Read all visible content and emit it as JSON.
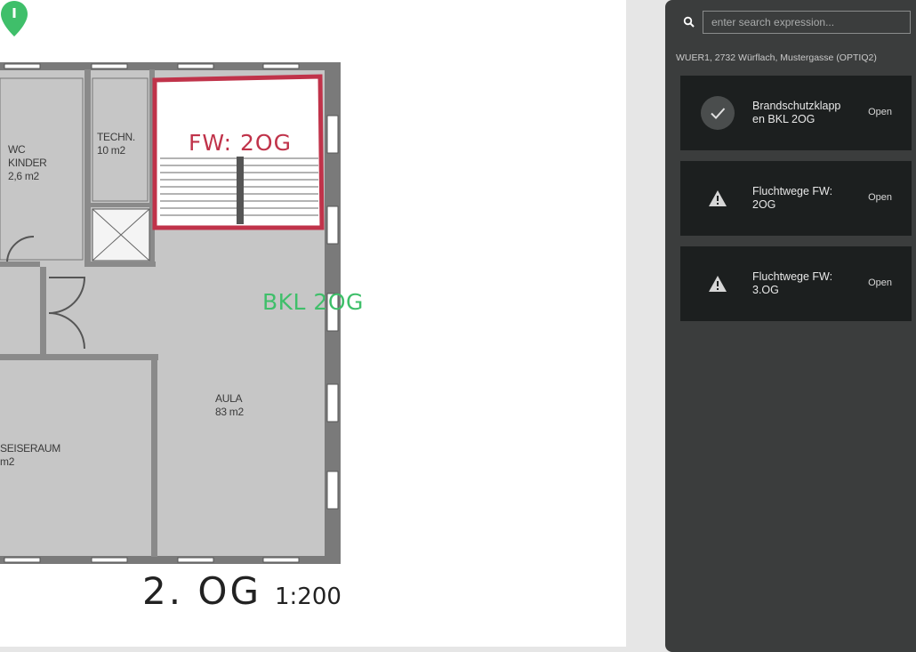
{
  "map": {
    "fire_route_label": "FW: 2OG",
    "marker_label": "BKL 2OG",
    "rooms": {
      "wc": [
        "WC",
        "KINDER",
        "2,6 m2"
      ],
      "technik": [
        "TECHN.",
        "10 m2"
      ],
      "aula": [
        "AULA",
        "83 m2"
      ],
      "speiseraum": [
        "SEISERAUM",
        "m2"
      ]
    },
    "floor_title": "2. OG",
    "scale": "1:200",
    "colors": {
      "fire_route": "#c0334a",
      "marker": "#3fbf6a"
    }
  },
  "panel": {
    "search": {
      "placeholder": "enter search expression..."
    },
    "location": "WUER1, 2732 Würflach, Mustergasse (OPTIQ2)",
    "items": [
      {
        "icon": "check-icon",
        "title": "Brandschutzklapp en BKL 2OG",
        "status": "Open"
      },
      {
        "icon": "warning-icon",
        "title": "Fluchtwege FW: 2OG",
        "status": "Open"
      },
      {
        "icon": "warning-icon",
        "title": "Fluchtwege FW: 3.OG",
        "status": "Open"
      }
    ]
  }
}
